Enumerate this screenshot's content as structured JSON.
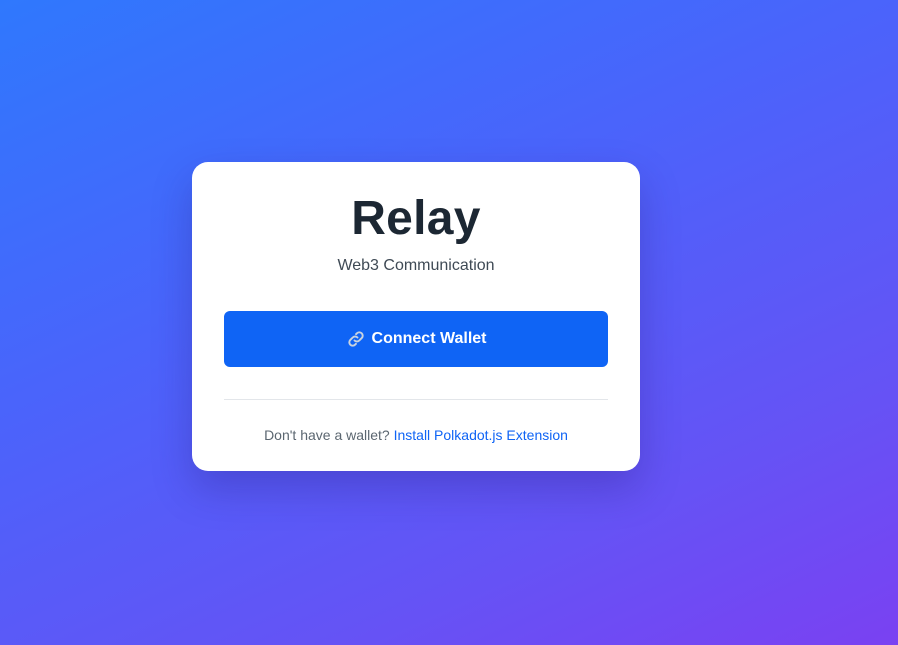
{
  "app": {
    "title": "Relay",
    "subtitle": "Web3 Communication"
  },
  "connect_button": {
    "label": "Connect Wallet",
    "icon": "link-icon"
  },
  "footer": {
    "prompt": "Don't have a wallet?",
    "link_label": "Install Polkadot.js Extension"
  },
  "colors": {
    "accent": "#0f64f5",
    "background_gradient_start": "#2f78fd",
    "background_gradient_end": "#7a41f2",
    "card": "#ffffff",
    "title": "#1c2733"
  }
}
